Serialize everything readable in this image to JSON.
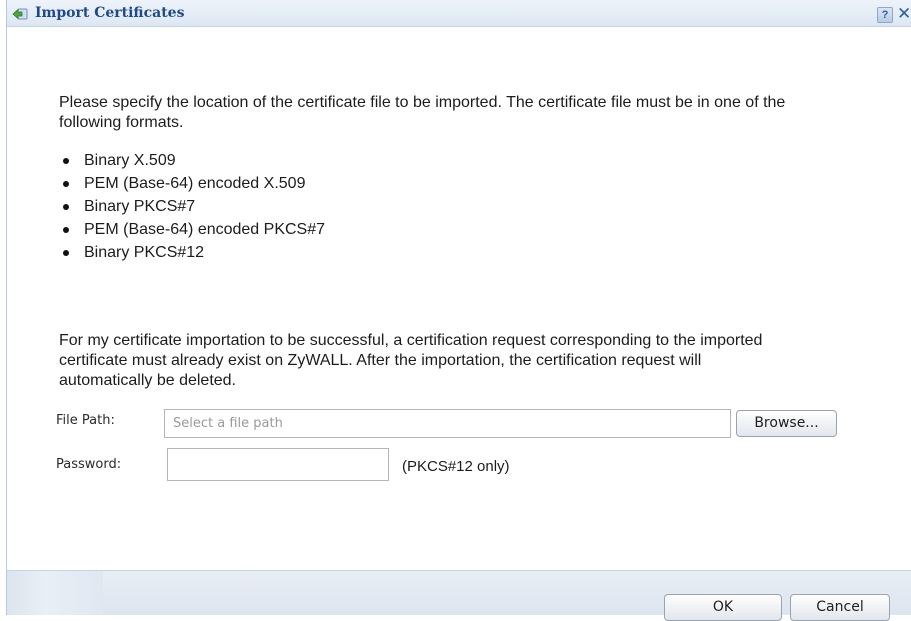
{
  "dialog": {
    "title": "Import Certificates",
    "help_label": "?",
    "close_label": "✕"
  },
  "content": {
    "intro": "Please specify the location of the certificate file to be imported. The certificate file must be in one of the following formats.",
    "formats": [
      "Binary X.509",
      "PEM (Base-64) encoded X.509",
      "Binary PKCS#7",
      "PEM (Base-64) encoded PKCS#7",
      "Binary PKCS#12"
    ],
    "note": "For my certificate importation to be successful, a certification request corresponding to the imported certificate must already exist on ZyWALL. After the importation, the certification request will automatically be deleted."
  },
  "form": {
    "file_path_label": "File Path:",
    "file_path_placeholder": "Select a file path",
    "browse_label": "Browse...",
    "password_label": "Password:",
    "password_value": "",
    "password_note": "(PKCS#12 only)"
  },
  "footer": {
    "ok_label": "OK",
    "cancel_label": "Cancel"
  },
  "colors": {
    "title_text": "#1f4a86",
    "titlebar_bg": "#dde7f3",
    "footer_bg": "#dce5f0"
  }
}
